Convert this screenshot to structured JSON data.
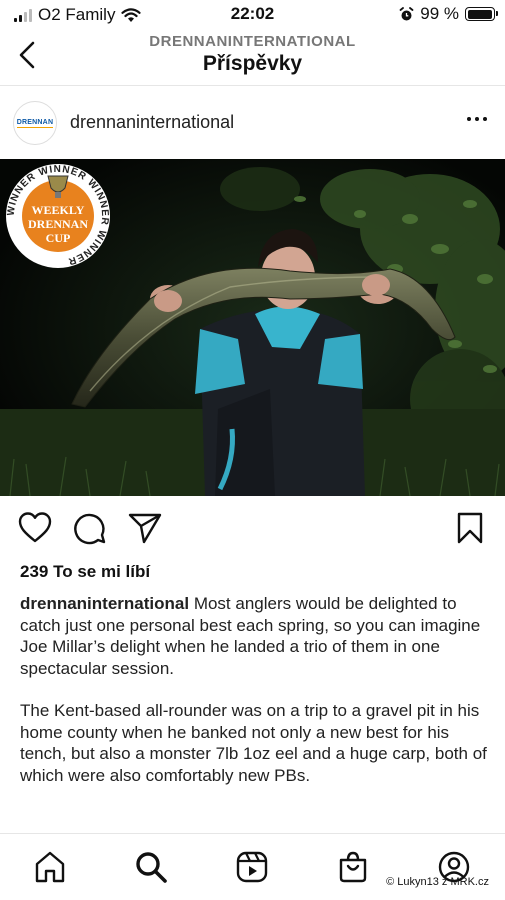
{
  "status_bar": {
    "carrier": "O2 Family",
    "time": "22:02",
    "battery_percent": "99 %",
    "battery_level": 0.99
  },
  "header": {
    "subtitle": "DRENNANINTERNATIONAL",
    "title": "Příspěvky"
  },
  "post": {
    "avatar_logo_text": "DRENNAN",
    "username": "drennaninternational",
    "badge": {
      "ring_text": "WINNER WINNER WINNER WINNER",
      "line1": "WEEKLY",
      "line2": "DRENNAN",
      "line3": "CUP"
    },
    "likes": "239 To se mi líbí",
    "caption_user": "drennaninternational",
    "caption_text": "Most anglers would be delighted to catch just one personal best each spring, so you can imagine Joe Millar’s delight when he landed a trio of them in one spectacular session.",
    "caption_paragraph2": "The Kent-based all-rounder was on a trip to a gravel pit in his home county when he banked not only a new best for his tench, but also a monster 7lb 1oz eel and a huge carp, both of which were also comfortably new PBs."
  },
  "icons": {
    "back": "chevron-left-icon",
    "more": "more-dots-icon",
    "like": "heart-icon",
    "comment": "comment-bubble-icon",
    "share": "paper-plane-icon",
    "save": "bookmark-icon",
    "tabs": [
      "home-icon",
      "search-icon",
      "reels-icon",
      "shop-bag-icon",
      "profile-icon"
    ]
  },
  "watermark": "© Lukyn13 z MRK.cz",
  "colors": {
    "text": "#111111",
    "secondary_text": "#777777",
    "badge_orange": "#e8821e",
    "brand_blue": "#0e5aa7"
  }
}
